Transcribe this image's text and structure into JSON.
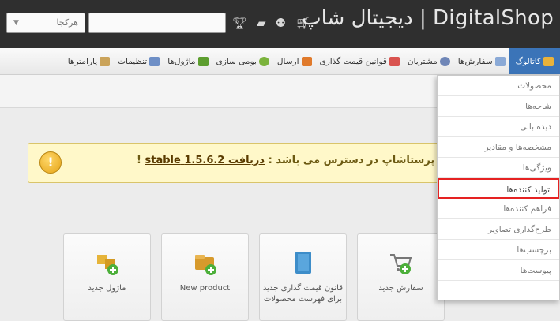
{
  "header": {
    "brand": "دیجیتال شاپ | DigitalShop",
    "search_scope": "هرکجا",
    "icons": [
      "cart-icon",
      "users-icon",
      "chat-icon",
      "trophy-icon"
    ]
  },
  "nav": {
    "items": [
      {
        "label": "کاتالوگ",
        "icon": "catalog-icon",
        "color": "#e8b23b",
        "active": true
      },
      {
        "label": "سفارش‌ها",
        "icon": "orders-icon",
        "color": "#8aa9d6"
      },
      {
        "label": "مشتریان",
        "icon": "customers-icon",
        "color": "#6f86b7"
      },
      {
        "label": "قوانین قیمت گذاری",
        "icon": "price-rules-icon",
        "color": "#d9534f"
      },
      {
        "label": "ارسال",
        "icon": "shipping-icon",
        "color": "#e07a2b"
      },
      {
        "label": "بومی سازی",
        "icon": "localization-icon",
        "color": "#7bb33c"
      },
      {
        "label": "ماژول‌ها",
        "icon": "modules-icon",
        "color": "#5d9e2f"
      },
      {
        "label": "تنظیمات",
        "icon": "preferences-icon",
        "color": "#6e8fc6"
      },
      {
        "label": "پارامترها",
        "icon": "parameters-icon",
        "color": "#caa35a"
      }
    ]
  },
  "notice": {
    "text_before": "نسخه جدید پرستاشاپ در دسترس می باشد : ",
    "link": "دریافت 1.5.6.2 stable",
    "text_after": " !"
  },
  "tiles": [
    {
      "label": "سفارش جدید",
      "icon": "new-order-icon"
    },
    {
      "label": "قانون قیمت گذاری جدید برای فهرست محصولات",
      "icon": "catalog-price-rule-icon"
    },
    {
      "label": "New product",
      "icon": "new-product-icon"
    },
    {
      "label": "ماژول جدید",
      "icon": "new-module-icon"
    }
  ],
  "dropdown": {
    "items": [
      {
        "label": "محصولات"
      },
      {
        "label": "شاخه‌ها"
      },
      {
        "label": "دیده بانی"
      },
      {
        "label": "مشخصه‌ها و مقادیر"
      },
      {
        "label": "ویژگی‌ها"
      },
      {
        "label": "تولید کننده‌ها",
        "highlight": true
      },
      {
        "label": "فراهم کننده‌ها"
      },
      {
        "label": "طرح‌گذاری تصاویر"
      },
      {
        "label": "برچسب‌ها"
      },
      {
        "label": "پیوست‌ها"
      }
    ],
    "highlight_color": "#e52222"
  }
}
